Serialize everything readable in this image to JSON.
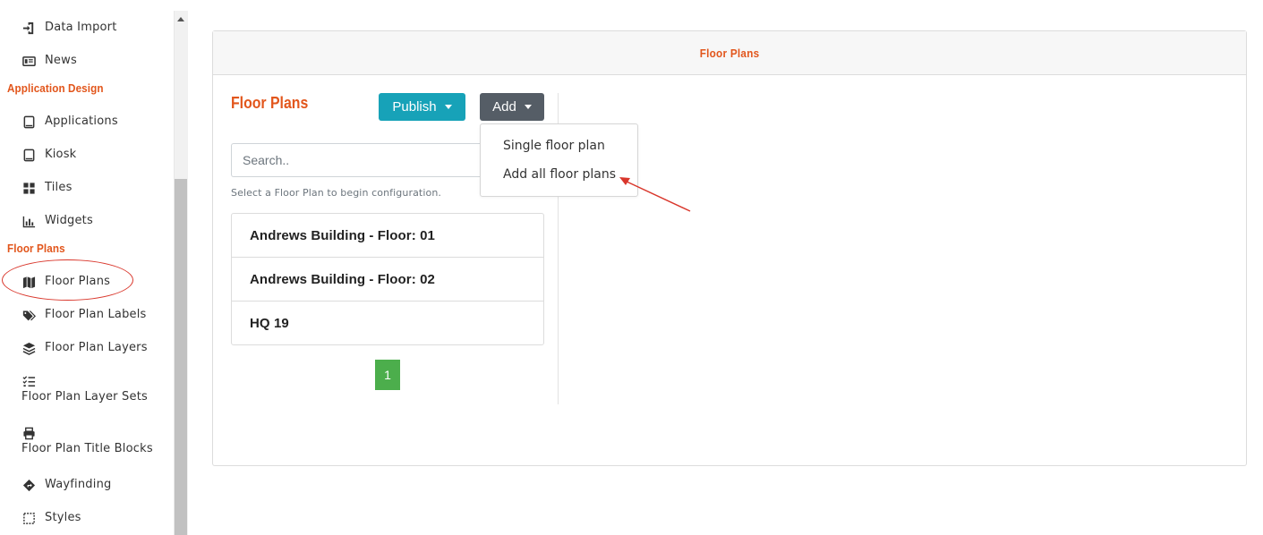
{
  "sidebar": {
    "items": [
      {
        "label": "Data Import",
        "icon": "file-import-icon"
      },
      {
        "label": "News",
        "icon": "newspaper-icon"
      },
      {
        "label": "Applications",
        "icon": "tablet-icon"
      },
      {
        "label": "Kiosk",
        "icon": "tablet-icon"
      },
      {
        "label": "Tiles",
        "icon": "grid-icon"
      },
      {
        "label": "Widgets",
        "icon": "bar-chart-icon"
      },
      {
        "label": "Floor Plans",
        "icon": "map-icon"
      },
      {
        "label": "Floor Plan Labels",
        "icon": "tags-icon"
      },
      {
        "label": "Floor Plan Layers",
        "icon": "layers-icon"
      },
      {
        "label": "Floor Plan Layer Sets",
        "icon": "list-check-icon"
      },
      {
        "label": "Floor Plan Title Blocks",
        "icon": "print-icon"
      },
      {
        "label": "Wayfinding",
        "icon": "directions-icon"
      },
      {
        "label": "Styles",
        "icon": "square-dashed-icon"
      }
    ],
    "sections": {
      "application_design": "Application Design",
      "floor_plans": "Floor Plans"
    }
  },
  "panel": {
    "title": "Floor Plans",
    "heading": "Floor Plans",
    "publish_label": "Publish",
    "add_label": "Add",
    "search_placeholder": "Search..",
    "hint": "Select a Floor Plan to begin configuration.",
    "floor_plans": [
      "Andrews Building - Floor: 01",
      "Andrews Building - Floor: 02",
      "HQ 19"
    ],
    "page": "1"
  },
  "add_menu": {
    "items": [
      "Single floor plan",
      "Add all floor plans"
    ]
  },
  "colors": {
    "accent": "#e2561c",
    "publish": "#17a2b8",
    "add": "#555d66",
    "pagination": "#4cae4c",
    "annotation": "#d9362b"
  }
}
